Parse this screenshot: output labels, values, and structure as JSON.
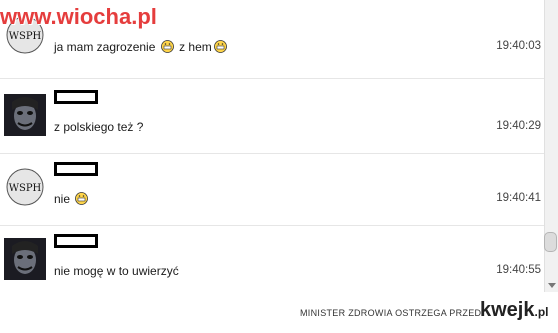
{
  "watermark": "www.wiocha.pl",
  "messages": [
    {
      "avatar": "wsph-logo",
      "text_prefix": "ja mam zagrozenie",
      "text_suffix": "z hem",
      "emoji": [
        "grin-emoji",
        "grin-emoji"
      ],
      "time": "19:40:03"
    },
    {
      "avatar": "dark-face",
      "text": "z polskiego też ?",
      "time": "19:40:29"
    },
    {
      "avatar": "wsph-logo",
      "text": "nie",
      "emoji": [
        "grin-emoji"
      ],
      "time": "19:40:41"
    },
    {
      "avatar": "dark-face",
      "text": "nie mogę w to uwierzyć",
      "time": "19:40:55"
    }
  ],
  "footer": {
    "warning": "MINISTER ZDROWIA OSTRZEGA PRZED",
    "brand": "kwejk",
    "brand_suffix": ".pl"
  },
  "colors": {
    "watermark": "#e53d3d",
    "emoji_fill": "#ffd54a"
  }
}
